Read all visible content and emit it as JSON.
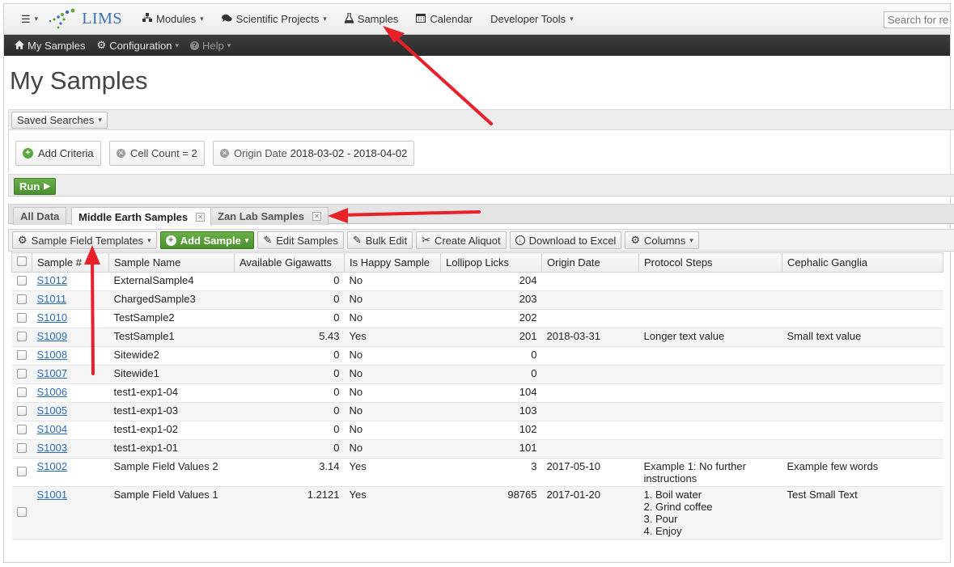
{
  "topnav": {
    "logo_text": "LIMS",
    "items": [
      {
        "label": "Modules"
      },
      {
        "label": "Scientific Projects"
      },
      {
        "label": "Samples"
      },
      {
        "label": "Calendar"
      },
      {
        "label": "Developer Tools"
      }
    ],
    "search_placeholder": "Search for re"
  },
  "subnav": {
    "items": [
      {
        "label": "My Samples"
      },
      {
        "label": "Configuration"
      },
      {
        "label": "Help"
      }
    ]
  },
  "page": {
    "title": "My Samples"
  },
  "search": {
    "saved_searches_label": "Saved Searches",
    "add_criteria_label": "Add Criteria",
    "criteria": [
      {
        "label": "Cell Count = 2"
      },
      {
        "label": "Origin Date",
        "value": "2018-03-02 - 2018-04-02"
      }
    ],
    "run_label": "Run"
  },
  "tabs": [
    {
      "label": "All Data"
    },
    {
      "label": "Middle Earth Samples"
    },
    {
      "label": "Zan Lab Samples"
    }
  ],
  "toolbar": {
    "sample_field_templates": "Sample Field Templates",
    "add_sample": "Add Sample",
    "edit_samples": "Edit Samples",
    "bulk_edit": "Bulk Edit",
    "create_aliquot": "Create Aliquot",
    "download_excel": "Download to Excel",
    "columns": "Columns"
  },
  "table": {
    "headers": [
      "Sample #",
      "Sample Name",
      "Available Gigawatts",
      "Is Happy Sample",
      "Lollipop Licks",
      "Origin Date",
      "Protocol Steps",
      "Cephalic Ganglia"
    ],
    "rows": [
      {
        "id": "S1012",
        "name": "ExternalSample4",
        "gigawatts": "0",
        "happy": "No",
        "licks": "204",
        "date": "",
        "protocol": "",
        "ganglia": ""
      },
      {
        "id": "S1011",
        "name": "ChargedSample3",
        "gigawatts": "0",
        "happy": "No",
        "licks": "203",
        "date": "",
        "protocol": "",
        "ganglia": ""
      },
      {
        "id": "S1010",
        "name": "TestSample2",
        "gigawatts": "0",
        "happy": "No",
        "licks": "202",
        "date": "",
        "protocol": "",
        "ganglia": ""
      },
      {
        "id": "S1009",
        "name": "TestSample1",
        "gigawatts": "5.43",
        "happy": "Yes",
        "licks": "201",
        "date": "2018-03-31",
        "protocol": "Longer text value",
        "ganglia": "Small text value"
      },
      {
        "id": "S1008",
        "name": "Sitewide2",
        "gigawatts": "0",
        "happy": "No",
        "licks": "0",
        "date": "",
        "protocol": "",
        "ganglia": ""
      },
      {
        "id": "S1007",
        "name": "Sitewide1",
        "gigawatts": "0",
        "happy": "No",
        "licks": "0",
        "date": "",
        "protocol": "",
        "ganglia": ""
      },
      {
        "id": "S1006",
        "name": "test1-exp1-04",
        "gigawatts": "0",
        "happy": "No",
        "licks": "104",
        "date": "",
        "protocol": "",
        "ganglia": ""
      },
      {
        "id": "S1005",
        "name": "test1-exp1-03",
        "gigawatts": "0",
        "happy": "No",
        "licks": "103",
        "date": "",
        "protocol": "",
        "ganglia": ""
      },
      {
        "id": "S1004",
        "name": "test1-exp1-02",
        "gigawatts": "0",
        "happy": "No",
        "licks": "102",
        "date": "",
        "protocol": "",
        "ganglia": ""
      },
      {
        "id": "S1003",
        "name": "test1-exp1-01",
        "gigawatts": "0",
        "happy": "No",
        "licks": "101",
        "date": "",
        "protocol": "",
        "ganglia": ""
      },
      {
        "id": "S1002",
        "name": "Sample Field Values 2",
        "gigawatts": "3.14",
        "happy": "Yes",
        "licks": "3",
        "date": "2017-05-10",
        "protocol": "Example 1: No further\ninstructions",
        "ganglia": "Example few words"
      },
      {
        "id": "S1001",
        "name": "Sample Field Values 1",
        "gigawatts": "1.2121",
        "happy": "Yes",
        "licks": "98765",
        "date": "2017-01-20",
        "protocol": "1. Boil water\n2. Grind coffee\n3. Pour\n4. Enjoy",
        "ganglia": "Test Small Text"
      }
    ]
  },
  "colors": {
    "accent_green": "#4b8e2f",
    "link_blue": "#2a6db5",
    "subnav_bg": "#2a2a2a",
    "annotation_red": "#e8202a"
  }
}
